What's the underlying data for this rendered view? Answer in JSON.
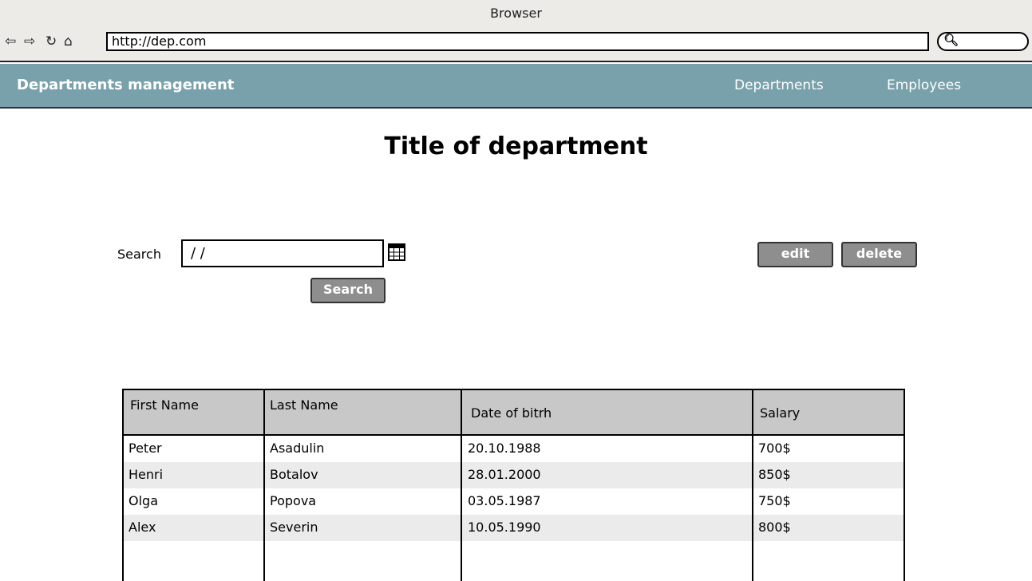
{
  "browser": {
    "window_title": "Browser",
    "url": "http://dep.com",
    "nav_icons": [
      "back-arrow-icon",
      "forward-arrow-icon",
      "reload-icon",
      "home-icon"
    ],
    "search_icon": "magnifier-icon"
  },
  "header": {
    "brand": "Departments management",
    "nav": [
      "Departments",
      "Employees"
    ],
    "background_color": "#78a1ab"
  },
  "main": {
    "title": "Title of department",
    "search": {
      "label": "Search",
      "value": "/ /",
      "button": "Search"
    },
    "actions": {
      "edit": "edit",
      "delete": "delete"
    }
  },
  "table": {
    "columns": [
      "First Name",
      "Last Name",
      "Date of bitrh",
      "Salary"
    ],
    "rows": [
      [
        "Peter",
        "Asadulin",
        "20.10.1988",
        "700$"
      ],
      [
        "Henri",
        "Botalov",
        "28.01.2000",
        "850$"
      ],
      [
        "Olga",
        "Popova",
        "03.05.1987",
        "750$"
      ],
      [
        "Alex",
        "Severin",
        "10.05.1990",
        "800$"
      ]
    ]
  }
}
